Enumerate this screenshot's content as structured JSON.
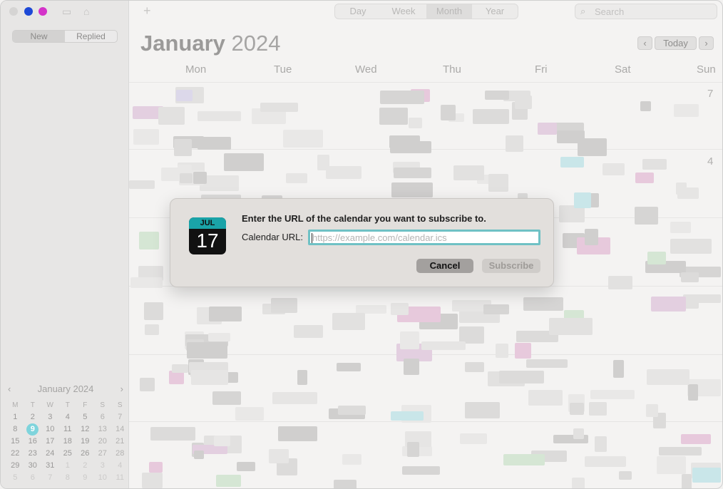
{
  "sidebar": {
    "segment": [
      {
        "label": "New",
        "active": true
      },
      {
        "label": "Replied",
        "active": false
      }
    ],
    "mini_calendar": {
      "title": "January 2024",
      "prev": "‹",
      "next": "›",
      "dow": [
        "M",
        "T",
        "W",
        "T",
        "F",
        "S",
        "S"
      ],
      "weeks": [
        [
          "1",
          "2",
          "3",
          "4",
          "5",
          "6",
          "7"
        ],
        [
          "8",
          "9",
          "10",
          "11",
          "12",
          "13",
          "14"
        ],
        [
          "15",
          "16",
          "17",
          "18",
          "19",
          "20",
          "21"
        ],
        [
          "22",
          "23",
          "24",
          "25",
          "26",
          "27",
          "28"
        ],
        [
          "29",
          "30",
          "31",
          "1",
          "2",
          "3",
          "4"
        ],
        [
          "5",
          "6",
          "7",
          "8",
          "9",
          "10",
          "11"
        ]
      ],
      "today": "9"
    }
  },
  "toolbar": {
    "add": "+",
    "views": [
      {
        "label": "Day"
      },
      {
        "label": "Week"
      },
      {
        "label": "Month",
        "active": true
      },
      {
        "label": "Year"
      }
    ],
    "search_placeholder": "Search"
  },
  "calendar": {
    "month": "January",
    "year": "2024",
    "nav": {
      "prev": "‹",
      "today": "Today",
      "next": "›"
    },
    "days": [
      "Mon",
      "Tue",
      "Wed",
      "Thu",
      "Fri",
      "Sat",
      "Sun"
    ],
    "visible_dates": [
      "7",
      "4"
    ]
  },
  "dialog": {
    "icon_month": "JUL",
    "icon_day": "17",
    "message": "Enter the URL of the calendar you want to subscribe to.",
    "url_label": "Calendar URL:",
    "url_placeholder": "https://example.com/calendar.ics",
    "url_value": "",
    "cancel": "Cancel",
    "subscribe": "Subscribe"
  },
  "colors": {
    "accent": "#6fc1c5",
    "today_circle": "#7fd4dc",
    "icon_header": "#1aa3a8"
  }
}
